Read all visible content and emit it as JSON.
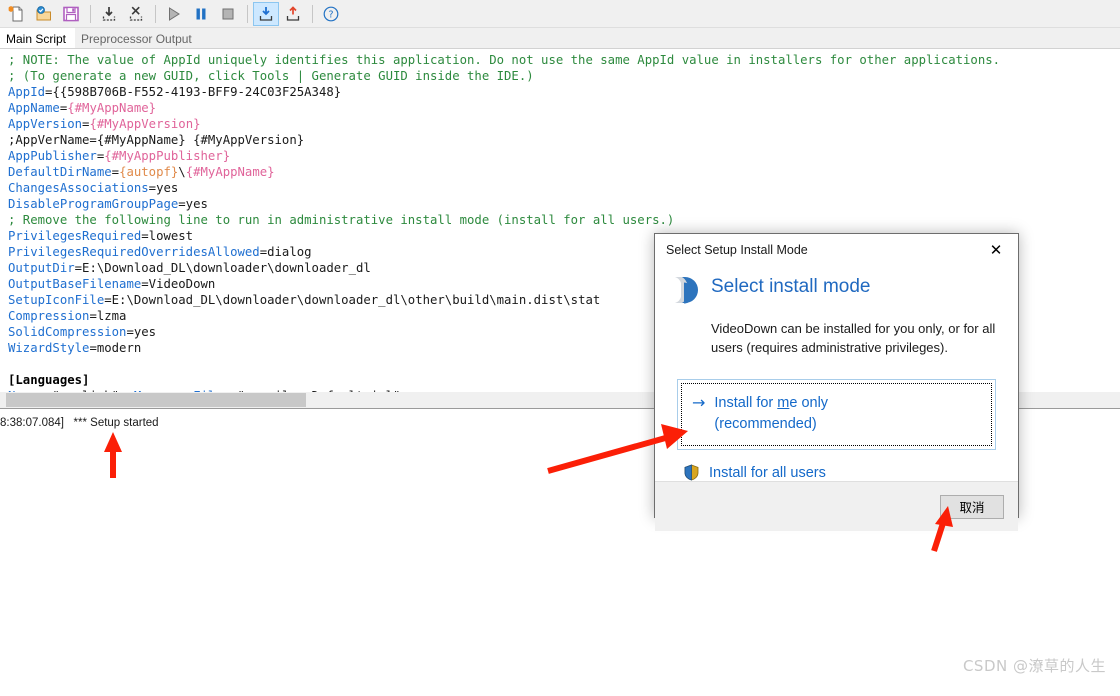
{
  "toolbar": {
    "buttons": [
      {
        "name": "new-file-icon",
        "title": "New"
      },
      {
        "name": "open-file-icon",
        "title": "Open"
      },
      {
        "name": "save-icon",
        "title": "Save"
      },
      {
        "name": "import-icon",
        "title": "Import"
      },
      {
        "name": "close-script-icon",
        "title": "Close"
      },
      {
        "name": "run-icon",
        "title": "Run"
      },
      {
        "name": "pause-icon",
        "title": "Pause"
      },
      {
        "name": "stop-icon",
        "title": "Stop"
      },
      {
        "name": "compile-icon",
        "title": "Compile"
      },
      {
        "name": "upload-icon",
        "title": "Publish"
      },
      {
        "name": "help-icon",
        "title": "Help"
      }
    ]
  },
  "tabs": [
    {
      "label": "Main Script",
      "selected": true
    },
    {
      "label": "Preprocessor Output",
      "selected": false
    }
  ],
  "editor": {
    "lines": [
      [
        {
          "t": "; NOTE: The value of AppId uniquely identifies this application. Do not use the same AppId value in installers for other applications.",
          "c": "c-comment"
        }
      ],
      [
        {
          "t": "; (To generate a new GUID, click Tools | Generate GUID inside the IDE.)",
          "c": "c-comment"
        }
      ],
      [
        {
          "t": "AppId",
          "c": "c-key"
        },
        {
          "t": "=",
          "c": "c-plain"
        },
        {
          "t": "{{598B706B-F552-4193-BFF9-24C03F25A348}",
          "c": "c-plain"
        }
      ],
      [
        {
          "t": "AppName",
          "c": "c-key"
        },
        {
          "t": "=",
          "c": "c-plain"
        },
        {
          "t": "{#MyAppName}",
          "c": "c-macro"
        }
      ],
      [
        {
          "t": "AppVersion",
          "c": "c-key"
        },
        {
          "t": "=",
          "c": "c-plain"
        },
        {
          "t": "{#MyAppVersion}",
          "c": "c-macro"
        }
      ],
      [
        {
          "t": ";AppVerName={#MyAppName} {#MyAppVersion}",
          "c": "c-plain"
        }
      ],
      [
        {
          "t": "AppPublisher",
          "c": "c-key"
        },
        {
          "t": "=",
          "c": "c-plain"
        },
        {
          "t": "{#MyAppPublisher}",
          "c": "c-macro"
        }
      ],
      [
        {
          "t": "DefaultDirName",
          "c": "c-key"
        },
        {
          "t": "=",
          "c": "c-plain"
        },
        {
          "t": "{autopf}",
          "c": "c-const"
        },
        {
          "t": "\\",
          "c": "c-plain"
        },
        {
          "t": "{#MyAppName}",
          "c": "c-macro"
        }
      ],
      [
        {
          "t": "ChangesAssociations",
          "c": "c-key"
        },
        {
          "t": "=yes",
          "c": "c-plain"
        }
      ],
      [
        {
          "t": "DisableProgramGroupPage",
          "c": "c-key"
        },
        {
          "t": "=yes",
          "c": "c-plain"
        }
      ],
      [
        {
          "t": "; Remove the following line to run in administrative install mode (install for all users.)",
          "c": "c-comment"
        }
      ],
      [
        {
          "t": "PrivilegesRequired",
          "c": "c-key"
        },
        {
          "t": "=lowest",
          "c": "c-plain"
        }
      ],
      [
        {
          "t": "PrivilegesRequiredOverridesAllowed",
          "c": "c-key"
        },
        {
          "t": "=dialog",
          "c": "c-plain"
        }
      ],
      [
        {
          "t": "OutputDir",
          "c": "c-key"
        },
        {
          "t": "=E:\\Download_DL\\downloader\\downloader_dl",
          "c": "c-plain"
        }
      ],
      [
        {
          "t": "OutputBaseFilename",
          "c": "c-key"
        },
        {
          "t": "=VideoDown",
          "c": "c-plain"
        }
      ],
      [
        {
          "t": "SetupIconFile",
          "c": "c-key"
        },
        {
          "t": "=E:\\Download_DL\\downloader\\downloader_dl\\other\\build\\main.dist\\stat",
          "c": "c-plain"
        }
      ],
      [
        {
          "t": "Compression",
          "c": "c-key"
        },
        {
          "t": "=lzma",
          "c": "c-plain"
        }
      ],
      [
        {
          "t": "SolidCompression",
          "c": "c-key"
        },
        {
          "t": "=yes",
          "c": "c-plain"
        }
      ],
      [
        {
          "t": "WizardStyle",
          "c": "c-key"
        },
        {
          "t": "=modern",
          "c": "c-plain"
        }
      ],
      [
        {
          "t": "",
          "c": "c-plain"
        }
      ],
      [
        {
          "t": "[Languages]",
          "c": "c-section"
        }
      ],
      [
        {
          "t": "Name",
          "c": "c-key"
        },
        {
          "t": ": \"english\"; ",
          "c": "c-plain"
        },
        {
          "t": "MessagesFile",
          "c": "c-key"
        },
        {
          "t": ": \"compiler:Default.isl\"",
          "c": "c-plain"
        }
      ]
    ]
  },
  "log": {
    "line": "8:38:07.084]   *** Setup started"
  },
  "dialog": {
    "title": "Select Setup Install Mode",
    "close_glyph": "✕",
    "heading": "Select install mode",
    "description": "VideoDown can be installed for you only, or for all users (requires administrative privileges).",
    "option_primary": {
      "arrow": "→",
      "line1_pre": "Install for ",
      "line1_underline": "m",
      "line1_post": "e only",
      "line2": "(recommended)"
    },
    "option_secondary": {
      "label": "Install for all users"
    },
    "cancel_label": "取消"
  },
  "watermark": {
    "text": "CSDN @潦草的人生"
  },
  "colors": {
    "accent_blue": "#1469c9",
    "heading_blue": "#2069c0",
    "annotation_red": "#fb1f07",
    "toolbar_bg": "#f0f0f0"
  }
}
